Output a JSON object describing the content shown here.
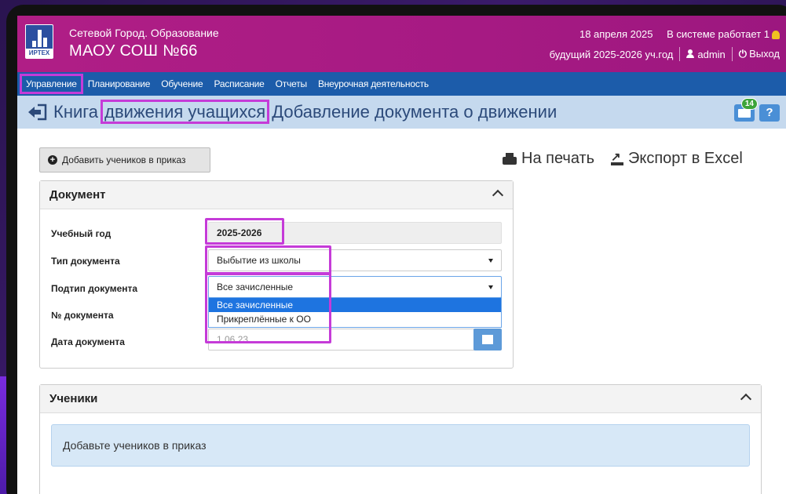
{
  "header": {
    "logo_text": "ИРТЕХ",
    "org_subtitle": "Сетевой Город. Образование",
    "org_name": "МАОУ СОШ №66",
    "date": "18 апреля 2025",
    "online": "В системе работает 1",
    "year": "будущий 2025-2026 уч.год",
    "user": "admin",
    "logout": "Выход"
  },
  "nav": {
    "items": [
      "Управление",
      "Планирование",
      "Обучение",
      "Расписание",
      "Отчеты",
      "Внеурочная деятельность"
    ]
  },
  "titlebar": {
    "title_prefix": "Книга ",
    "title_highlight": "движения учащихся",
    "title_suffix": " Добавление документа о движении",
    "mail_count": "14",
    "help": "?"
  },
  "toolbar": {
    "add_students": "Добавить учеников в приказ",
    "print": "На печать",
    "export": "Экспорт в Excel"
  },
  "document": {
    "title": "Документ",
    "labels": {
      "year": "Учебный год",
      "type": "Тип документа",
      "subtype": "Подтип документа",
      "number": "№ документа",
      "date": "Дата документа"
    },
    "values": {
      "year": "2025-2026",
      "type": "Выбытие из школы",
      "subtype": "Все зачисленные",
      "number": "",
      "date": "1.06.23"
    },
    "subtype_options": [
      "Все зачисленные",
      "Прикреплённые к ОО"
    ]
  },
  "students": {
    "title": "Ученики",
    "empty_message": "Добавьте учеников в приказ"
  },
  "colors": {
    "header": "#b01e86",
    "nav": "#1c5caa",
    "titlebar": "#c5d9ee",
    "highlight": "#c53bd8"
  }
}
